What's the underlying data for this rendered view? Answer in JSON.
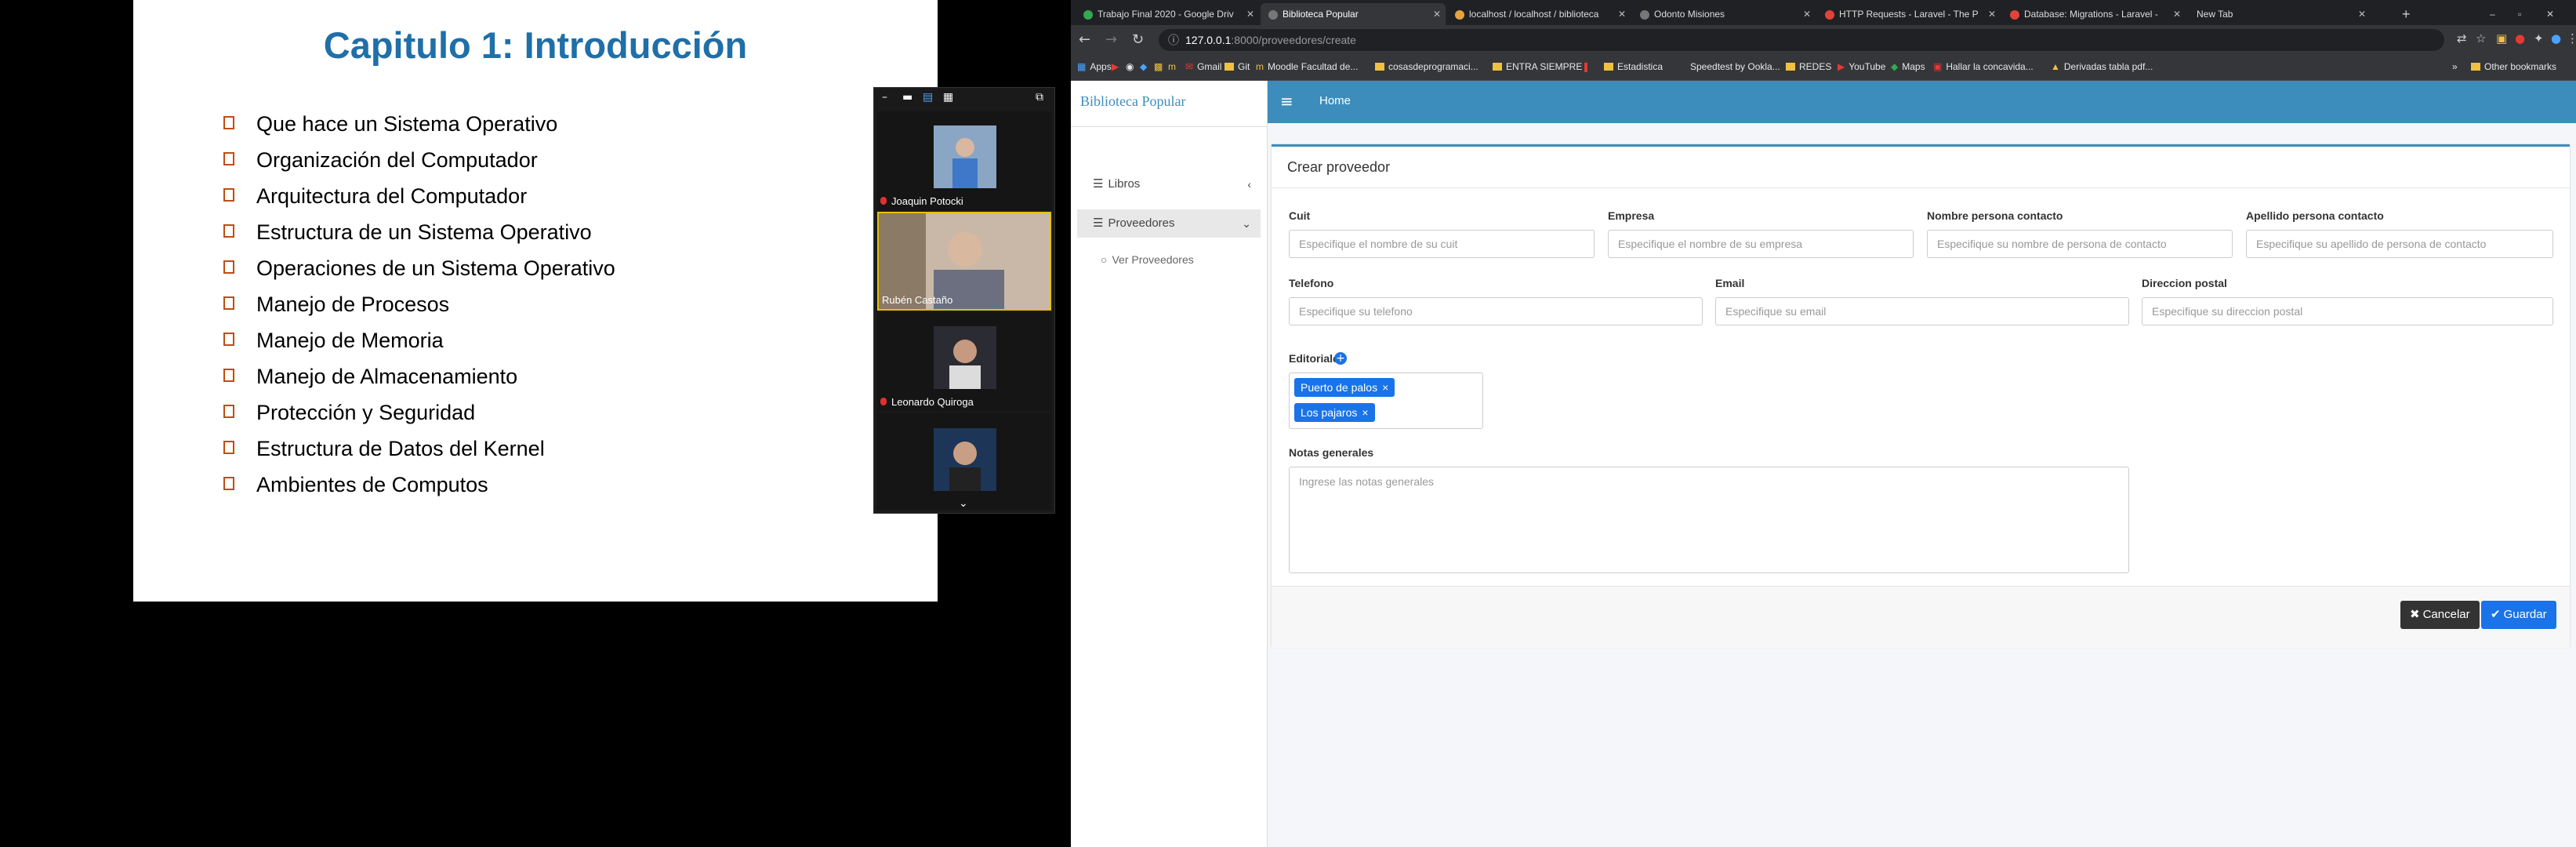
{
  "slide": {
    "title": "Capitulo 1: Introducción",
    "bullets": [
      "Que hace un Sistema Operativo",
      "Organización del Computador",
      "Arquitectura del Computador",
      "Estructura de un Sistema Operativo",
      "Operaciones de un Sistema Operativo",
      "Manejo de Procesos",
      "Manejo de Memoria",
      "Manejo de Almacenamiento",
      "Protección y Seguridad",
      "Estructura de Datos del Kernel",
      "Ambientes de Computos"
    ]
  },
  "video": {
    "participants": [
      {
        "name": "Joaquin Potocki"
      },
      {
        "name": "Rubén Castaño"
      },
      {
        "name": "Leonardo Quiroga"
      },
      {
        "name": ""
      }
    ]
  },
  "browser": {
    "tabs": [
      {
        "label": "Trabajo Final 2020 - Google Driv"
      },
      {
        "label": "Biblioteca Popular"
      },
      {
        "label": "localhost / localhost / biblioteca"
      },
      {
        "label": "Odonto Misiones"
      },
      {
        "label": "HTTP Requests - Laravel - The P"
      },
      {
        "label": "Database: Migrations - Laravel -"
      },
      {
        "label": "New Tab"
      }
    ],
    "url_host": "127.0.0.1",
    "url_rest": ":8000/proveedores/create",
    "bookmarks": [
      "Apps",
      "Gmail",
      "Git",
      "Moodle Facultad de...",
      "cosasdeprogramaci...",
      "ENTRA SIEMPRE",
      "Estadistica",
      "Speedtest by Ookla...",
      "REDES",
      "YouTube",
      "Maps",
      "Hallar la concavida...",
      "Derivadas tabla pdf...",
      "Other bookmarks"
    ]
  },
  "app": {
    "brand": "Biblioteca Popular",
    "sidebar": [
      {
        "label": "Libros"
      },
      {
        "label": "Proveedores"
      },
      {
        "label": "Ver Proveedores"
      }
    ],
    "header_home": "Home"
  },
  "form": {
    "title": "Crear proveedor",
    "cuit_label": "Cuit",
    "cuit_placeholder": "Especifique el nombre de su cuit",
    "empresa_label": "Empresa",
    "empresa_placeholder": "Especifique el nombre de su empresa",
    "nombre_label": "Nombre persona contacto",
    "nombre_placeholder": "Especifique su nombre de persona de contacto",
    "apellido_label": "Apellido persona contacto",
    "apellido_placeholder": "Especifique su apellido de persona de contacto",
    "telefono_label": "Telefono",
    "telefono_placeholder": "Especifique su telefono",
    "email_label": "Email",
    "email_placeholder": "Especifique su email",
    "direccion_label": "Direccion postal",
    "direccion_placeholder": "Especifique su direccion postal",
    "editoriales_label": "Editoriales",
    "editoriales": [
      "Puerto de palos",
      "Los pajaros"
    ],
    "notas_label": "Notas generales",
    "notas_placeholder": "Ingrese las notas generales",
    "cancel_label": "Cancelar",
    "save_label": "Guardar"
  }
}
